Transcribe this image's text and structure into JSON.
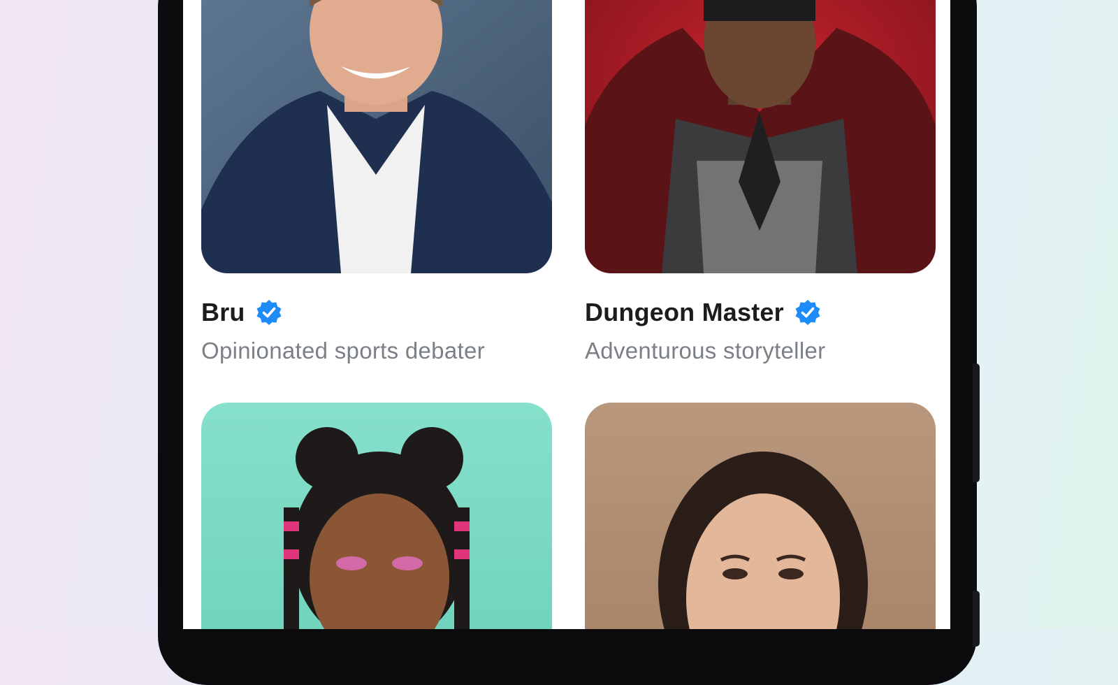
{
  "colors": {
    "badge_blue": "#1d8cf8",
    "name_text": "#1c1c1e",
    "desc_text": "#7b7f86"
  },
  "characters": [
    {
      "name": "Bru",
      "description": "Opinionated sports debater",
      "verified": true,
      "icon": "verified-badge-icon"
    },
    {
      "name": "Dungeon Master",
      "description": "Adventurous storyteller",
      "verified": true,
      "icon": "verified-badge-icon"
    },
    {
      "photo_bg": "#7cdcc4"
    },
    {
      "photo_bg": "#b8957a"
    }
  ]
}
